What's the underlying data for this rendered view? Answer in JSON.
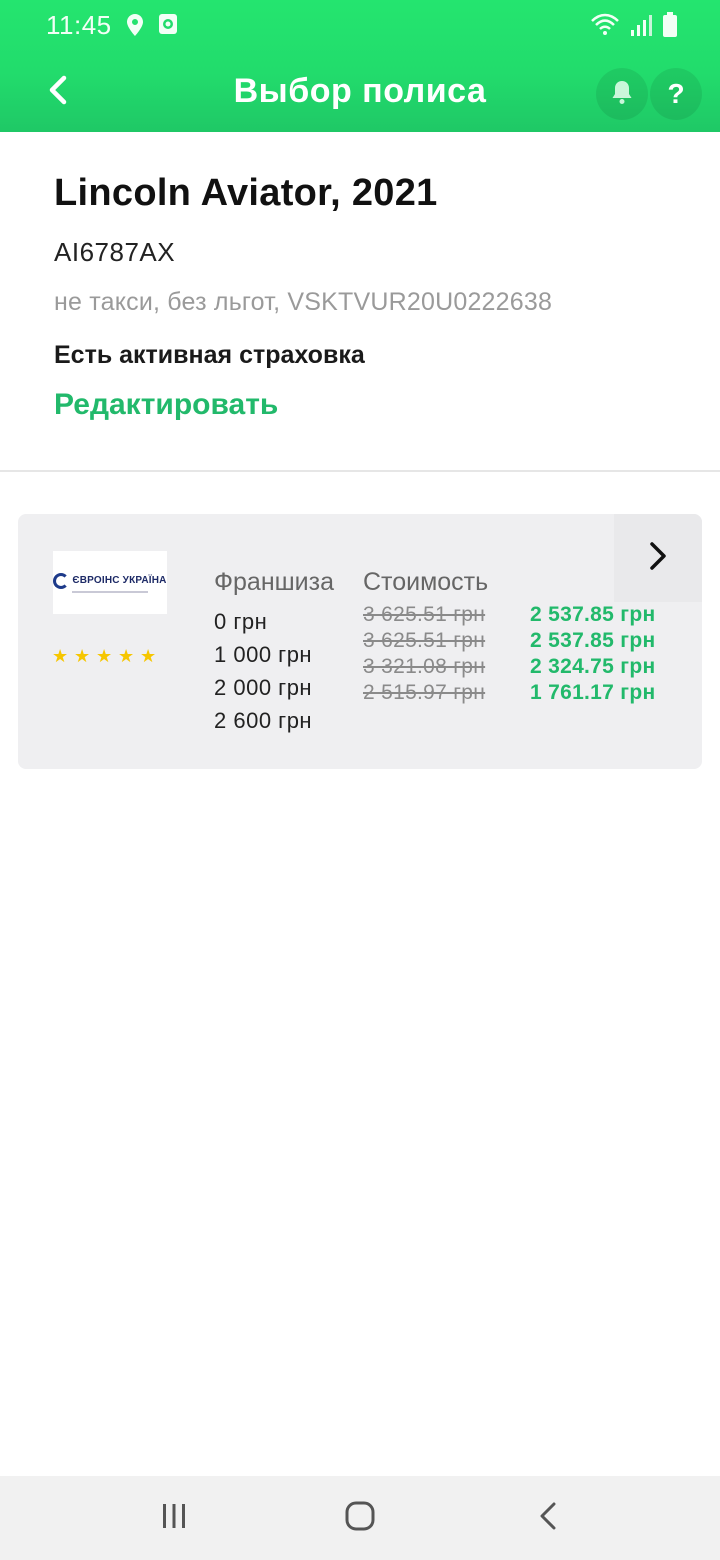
{
  "status_bar": {
    "time": "11:45",
    "icons_left": [
      "location-icon",
      "camera-notification-icon"
    ],
    "icons_right": [
      "wifi-icon",
      "signal-icon",
      "battery-icon"
    ]
  },
  "app_bar": {
    "title": "Выбор полиса",
    "help_label": "?",
    "icons": [
      "back-arrow-icon",
      "bell-icon"
    ]
  },
  "vehicle": {
    "name": "Lincoln Aviator, 2021",
    "plate": "AI6787AX",
    "details": "не такси, без льгот, VSKTVUR20U0222638",
    "insurance_status": "Есть активная страховка",
    "edit_label": "Редактировать"
  },
  "offer": {
    "insurer_logo_text": "ЄВРОІНС УКРАЇНА",
    "rating_stars": 5,
    "franchise_header": "Франшиза",
    "cost_header": "Стоимость",
    "franchises": [
      "0 грн",
      "1 000 грн",
      "2 000 грн",
      "2 600 грн"
    ],
    "old_prices": [
      "3 625.51 грн",
      "3 625.51 грн",
      "3 321.08 грн",
      "2 515.97 грн"
    ],
    "new_prices": [
      "2 537.85 грн",
      "2 537.85 грн",
      "2 324.75 грн",
      "1 761.17 грн"
    ]
  },
  "colors": {
    "header_green": "#22dc6c",
    "accent_green": "#22b96b",
    "card_bg": "#efeff1",
    "star_yellow": "#f6c600"
  },
  "nav_bar": {
    "icons": [
      "recent-apps-icon",
      "home-icon",
      "back-icon"
    ]
  }
}
